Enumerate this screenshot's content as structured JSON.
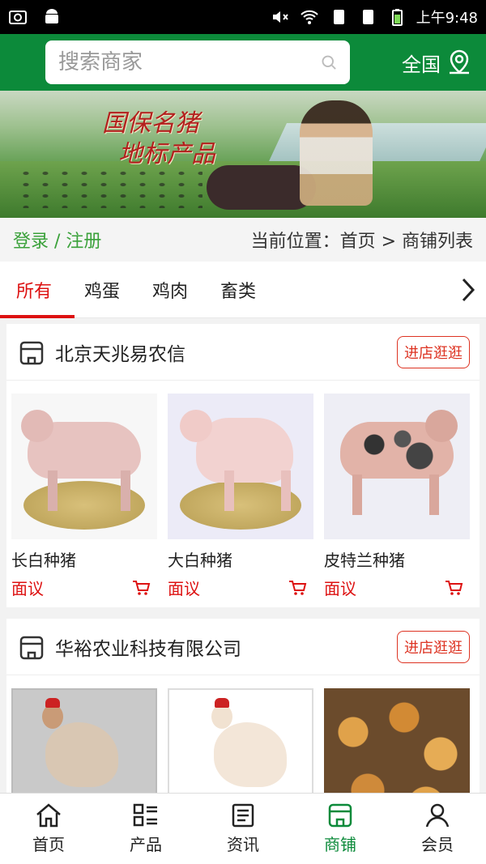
{
  "statusbar": {
    "time": "上午9:48",
    "icons": [
      "screenshot-icon",
      "android-icon",
      "mute-icon",
      "wifi-icon",
      "sim1-icon",
      "sim2-icon",
      "battery-icon"
    ]
  },
  "header": {
    "search_placeholder": "搜索商家",
    "region_label": "全国",
    "accent_color": "#0c8a3a"
  },
  "banner": {
    "title_line1": "国保名猪",
    "title_line2": "地标产品"
  },
  "breadcrumb": {
    "login_label": "登录 / 注册",
    "path_label": "当前位置：首页 > 商铺列表"
  },
  "tabs": [
    {
      "label": "所有",
      "active": true
    },
    {
      "label": "鸡蛋",
      "active": false
    },
    {
      "label": "鸡肉",
      "active": false
    },
    {
      "label": "畜类",
      "active": false
    }
  ],
  "stores": [
    {
      "name": "北京天兆易农信",
      "visit_label": "进店逛逛",
      "products": [
        {
          "name": "长白种猪",
          "price": "面议"
        },
        {
          "name": "大白种猪",
          "price": "面议"
        },
        {
          "name": "皮特兰种猪",
          "price": "面议"
        }
      ]
    },
    {
      "name": "华裕农业科技有限公司",
      "visit_label": "进店逛逛",
      "products": [
        {
          "name": "",
          "price": ""
        },
        {
          "name": "",
          "price": ""
        },
        {
          "name": "",
          "price": ""
        }
      ]
    }
  ],
  "bottomnav": [
    {
      "label": "首页",
      "icon": "home-icon",
      "active": false
    },
    {
      "label": "产品",
      "icon": "product-list-icon",
      "active": false
    },
    {
      "label": "资讯",
      "icon": "news-icon",
      "active": false
    },
    {
      "label": "商铺",
      "icon": "store-icon",
      "active": true
    },
    {
      "label": "会员",
      "icon": "user-icon",
      "active": false
    }
  ]
}
